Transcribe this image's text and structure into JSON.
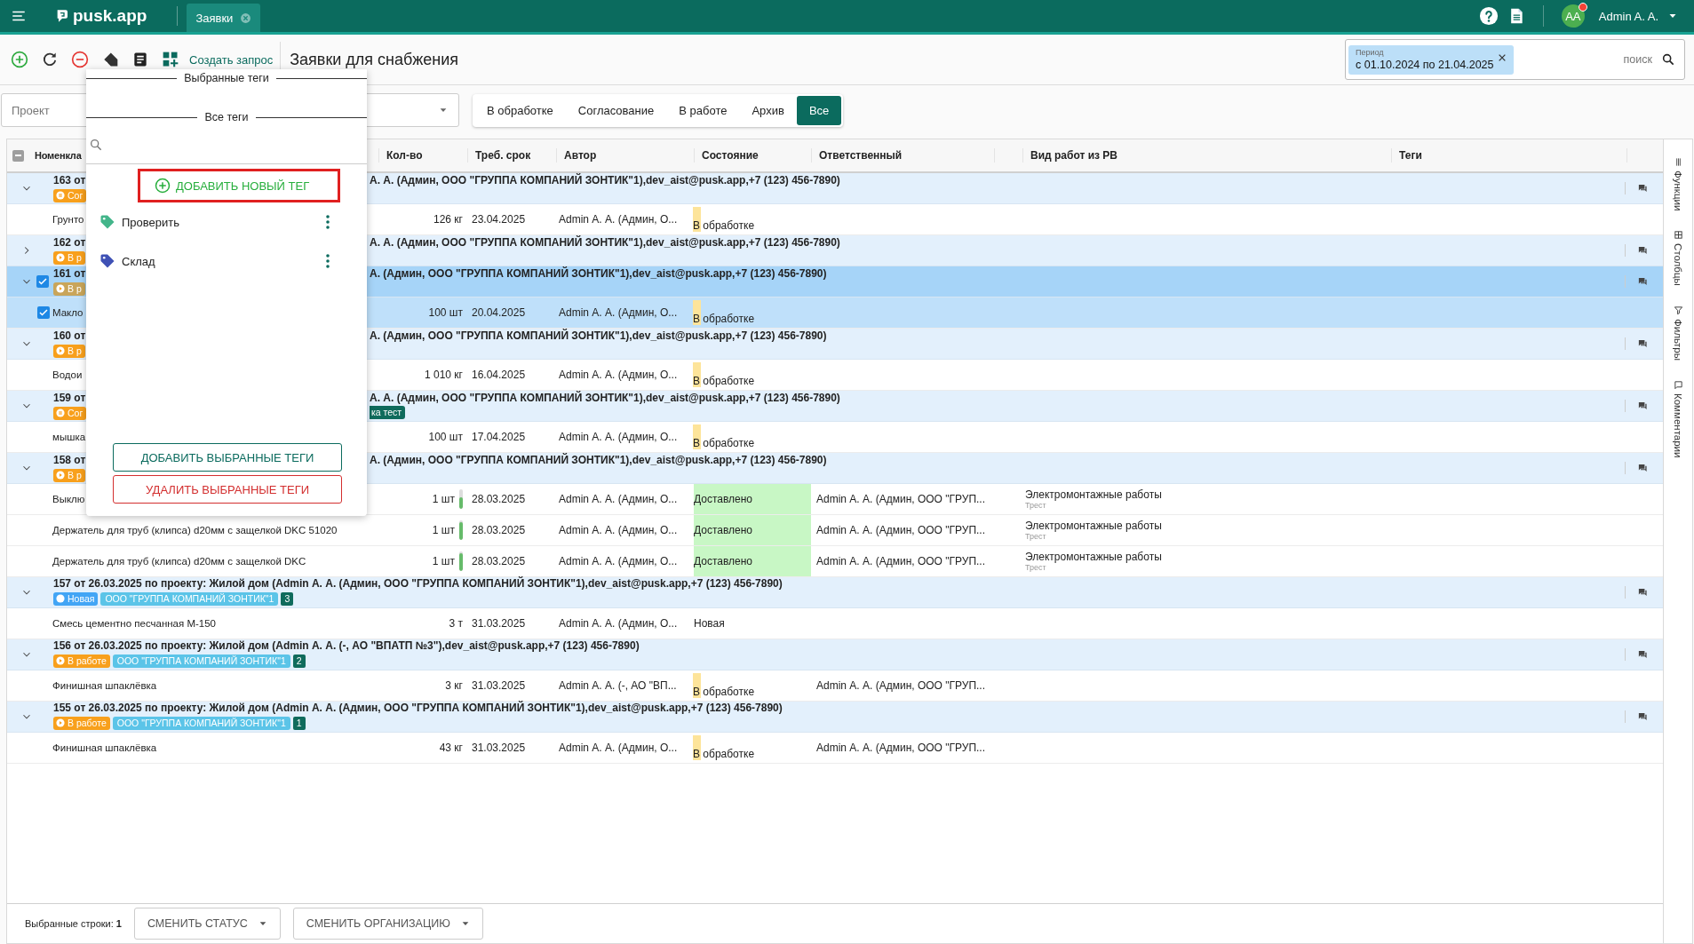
{
  "topbar": {
    "logo": "pusk.app",
    "tabs": [
      {
        "label": "Заявки",
        "selected": true
      }
    ],
    "avatar": "AA",
    "notification": true,
    "user": "Admin A. A."
  },
  "toolbar": {
    "create_label": "Создать запрос",
    "title": "Заявки для снабжения",
    "period_label": "Период",
    "period_value": "с 01.10.2024 по 21.04.2025",
    "search_placeholder": "поиск"
  },
  "filters": {
    "project_placeholder": "Проект",
    "segments": [
      {
        "label": "В обработке",
        "selected": false
      },
      {
        "label": "Согласование",
        "selected": false
      },
      {
        "label": "В работе",
        "selected": false
      },
      {
        "label": "Архив",
        "selected": false
      },
      {
        "label": "Все",
        "selected": true
      }
    ]
  },
  "tag_popup": {
    "selected_heading": "Выбранные теги",
    "all_heading": "Все теги",
    "add_new": "ДОБАВИТЬ НОВЫЙ ТЕГ",
    "tags": [
      {
        "label": "Проверить",
        "color": "#43b58a"
      },
      {
        "label": "Склад",
        "color": "#3f51b5"
      }
    ],
    "add_selected": "ДОБАВИТЬ ВЫБРАННЫЕ ТЕГИ",
    "remove_selected": "УДАЛИТЬ ВЫБРАННЫЕ ТЕГИ"
  },
  "table": {
    "select_all": {
      "indeterminate": true
    },
    "columns": [
      "Номенкла",
      "Кол-во",
      "Треб. срок",
      "Автор",
      "Состояние",
      "Ответственный",
      "Вид работ из РВ",
      "Теги"
    ],
    "groups": [
      {
        "title": "163 от",
        "title_end": "А. А. (Админ, ООО \"ГРУППА КОМПАНИЙ ЗОНТИК\"1),dev_aist@pusk.app,+7 (123) 456-7890)",
        "expanded": true,
        "selected": false,
        "status": {
          "kind": "approval",
          "label": "Сог"
        },
        "items": [
          {
            "name": "Грунто",
            "qty": "126 кг",
            "date": "23.04.2025",
            "author": "Admin А. А. (Админ, О...",
            "status": {
              "kind": "processing",
              "label": "В обработке"
            },
            "selected": false
          }
        ]
      },
      {
        "title": "162 от",
        "title_end": "А. А. (Админ, ООО \"ГРУППА КОМПАНИЙ ЗОНТИК\"1),dev_aist@pusk.app,+7 (123) 456-7890)",
        "expanded": false,
        "selected": false,
        "status": {
          "kind": "in_work",
          "label": "В р"
        }
      },
      {
        "title": "161 от",
        "title_end": "А. (Админ, ООО \"ГРУППА КОМПАНИЙ ЗОНТИК\"1),dev_aist@pusk.app,+7 (123) 456-7890)",
        "expanded": true,
        "selected": true,
        "status": {
          "kind": "in_work",
          "label": "В р"
        },
        "items": [
          {
            "name": "Макло",
            "qty": "100 шт",
            "date": "20.04.2025",
            "author": "Admin А. А. (Админ, О...",
            "status": {
              "kind": "processing",
              "label": "В обработке"
            },
            "selected": true
          }
        ]
      },
      {
        "title": "160 от",
        "title_end": "А. (Админ, ООО \"ГРУППА КОМПАНИЙ ЗОНТИК\"1),dev_aist@pusk.app,+7 (123) 456-7890)",
        "expanded": true,
        "selected": false,
        "status": {
          "kind": "in_work",
          "label": "В р"
        },
        "items": [
          {
            "name": "Водои",
            "qty": "1 010 кг",
            "date": "16.04.2025",
            "author": "Admin А. А. (Админ, О...",
            "status": {
              "kind": "processing",
              "label": "В обработке"
            },
            "selected": false
          }
        ]
      },
      {
        "title": "159 от",
        "title_end": "А. А. (Админ, ООО \"ГРУППА КОМПАНИЙ ЗОНТИК\"1),dev_aist@pusk.app,+7 (123) 456-7890)",
        "extra_tag": "ка тест",
        "expanded": true,
        "selected": false,
        "status": {
          "kind": "approval",
          "label": "Сог"
        },
        "items": [
          {
            "name": "мышка",
            "qty": "100 шт",
            "date": "17.04.2025",
            "author": "Admin А. А. (Админ, О...",
            "status": {
              "kind": "processing",
              "label": "В обработке"
            },
            "selected": false
          }
        ]
      },
      {
        "title": "158 от",
        "title_end": "А. (Админ, ООО \"ГРУППА КОМПАНИЙ ЗОНТИК\"1),dev_aist@pusk.app,+7 (123) 456-7890)",
        "expanded": true,
        "selected": false,
        "status": {
          "kind": "in_work",
          "label": "В р"
        },
        "items": [
          {
            "name": "Выклю",
            "qty": "1 шт",
            "level": 0.6,
            "date": "28.03.2025",
            "author": "Admin А. А. (Админ, О...",
            "status": {
              "kind": "delivered",
              "label": "Доставлено"
            },
            "responsible": "Admin А. А. (Админ, ООО \"ГРУП...",
            "work_type": "Электромонтажные работы",
            "work_org": "Трест",
            "selected": false
          },
          {
            "name": "Держатель для труб (клипса) d20мм с защелкой DKC 51020",
            "qty": "1 шт",
            "level": 0.9,
            "date": "28.03.2025",
            "author": "Admin А. А. (Админ, О...",
            "status": {
              "kind": "delivered",
              "label": "Доставлено"
            },
            "responsible": "Admin А. А. (Админ, ООО \"ГРУП...",
            "work_type": "Электромонтажные работы",
            "work_org": "Трест",
            "selected": false
          },
          {
            "name": "Держатель для труб (клипса) d20мм с защелкой DKC",
            "qty": "1 шт",
            "level": 0.9,
            "date": "28.03.2025",
            "author": "Admin А. А. (Админ, О...",
            "status": {
              "kind": "delivered",
              "label": "Доставлено"
            },
            "responsible": "Admin А. А. (Админ, ООО \"ГРУП...",
            "work_type": "Электромонтажные работы",
            "work_org": "Трест",
            "selected": false
          }
        ]
      },
      {
        "title": "157 от 26.03.2025 по проекту: Жилой дом (Admin А. А. (Админ, ООО \"ГРУППА КОМПАНИЙ ЗОНТИК\"1),dev_aist@pusk.app,+7 (123) 456-7890)",
        "expanded": true,
        "selected": false,
        "status": {
          "kind": "new",
          "label": "Новая"
        },
        "org": "ООО \"ГРУППА КОМПАНИЙ ЗОНТИК\"1",
        "count": "3",
        "items": [
          {
            "name": "Смесь цементно песчанная М-150",
            "qty": "3 т",
            "date": "31.03.2025",
            "author": "Admin А. А. (Админ, О...",
            "status": {
              "kind": "new",
              "label": "Новая"
            },
            "selected": false
          }
        ]
      },
      {
        "title": "156 от 26.03.2025 по проекту: Жилой дом (Admin А. А. (-, АО \"ВПАТП №3\"),dev_aist@pusk.app,+7 (123) 456-7890)",
        "expanded": true,
        "selected": false,
        "status": {
          "kind": "in_work",
          "label": "В работе"
        },
        "org": "ООО \"ГРУППА КОМПАНИЙ ЗОНТИК\"1",
        "count": "2",
        "items": [
          {
            "name": "Финишная шпаклёвка",
            "qty": "3 кг",
            "date": "31.03.2025",
            "author": "Admin А. А. (-, АО \"ВП...",
            "status": {
              "kind": "processing",
              "label": "В обработке"
            },
            "responsible": "Admin А. А. (Админ, ООО \"ГРУП...",
            "selected": false
          }
        ]
      },
      {
        "title": "155 от 26.03.2025 по проекту: Жилой дом (Admin А. А. (Админ, ООО \"ГРУППА КОМПАНИЙ ЗОНТИК\"1),dev_aist@pusk.app,+7 (123) 456-7890)",
        "expanded": true,
        "selected": false,
        "status": {
          "kind": "in_work",
          "label": "В работе"
        },
        "org": "ООО \"ГРУППА КОМПАНИЙ ЗОНТИК\"1",
        "count": "1",
        "items": [
          {
            "name": "Финишная шпаклёвка",
            "qty": "43 кг",
            "date": "31.03.2025",
            "author": "Admin А. А. (Админ, О...",
            "status": {
              "kind": "processing",
              "label": "В обработке"
            },
            "responsible": "Admin А. А. (Админ, ООО \"ГРУП...",
            "selected": false
          }
        ]
      }
    ]
  },
  "side_panel": [
    {
      "kind": "functions",
      "label": "Функции"
    },
    {
      "kind": "columns",
      "label": "Столбцы"
    },
    {
      "kind": "filters",
      "label": "Фильтры"
    },
    {
      "kind": "comments",
      "label": "Комментарии"
    }
  ],
  "status_bar": {
    "selected_label": "Выбранные строки:",
    "selected_count": "1",
    "buttons": [
      "СМЕНИТЬ СТАТУС",
      "СМЕНИТЬ ОРГАНИЗАЦИЮ"
    ]
  }
}
